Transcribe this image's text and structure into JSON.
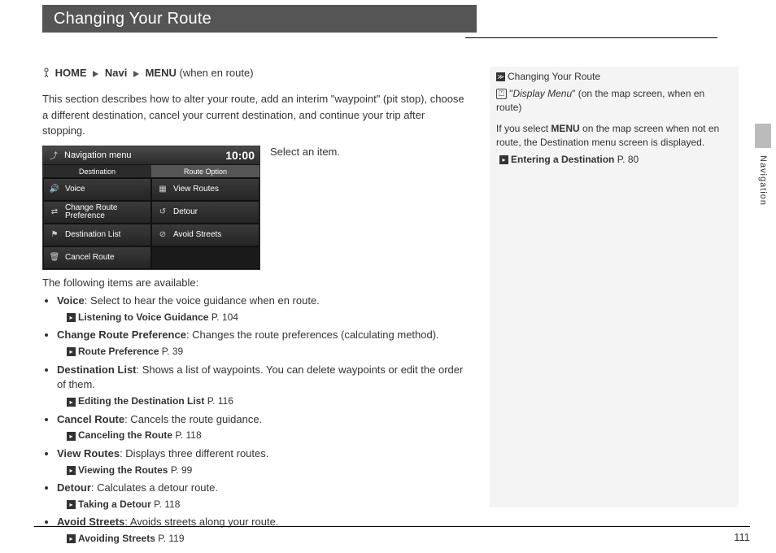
{
  "header": {
    "title": "Changing Your Route"
  },
  "breadcrumb": {
    "home": "HOME",
    "navi": "Navi",
    "menu": "MENU",
    "suffix": "(when en route)"
  },
  "intro": "This section describes how to alter your route, add an interim \"waypoint\" (pit stop), choose a different destination, cancel your current destination, and continue your trip after stopping.",
  "screenshot": {
    "title": "Navigation menu",
    "clock": "10:00",
    "tab_dest": "Destination",
    "tab_route": "Route Option",
    "cells": {
      "voice": "Voice",
      "view_routes": "View Routes",
      "change_pref_l1": "Change Route",
      "change_pref_l2": "Preference",
      "detour": "Detour",
      "dest_list": "Destination List",
      "avoid": "Avoid Streets",
      "cancel": "Cancel Route"
    }
  },
  "instruction": "Select an item.",
  "following": "The following items are available:",
  "items": {
    "voice": {
      "title": "Voice",
      "desc": ": Select to hear the voice guidance when en route.",
      "xref_label": "Listening to Voice Guidance",
      "xref_page": "P. 104"
    },
    "pref": {
      "title": "Change Route Preference",
      "desc": ": Changes the route preferences (calculating method).",
      "xref_label": "Route Preference",
      "xref_page": "P. 39"
    },
    "destlist": {
      "title": "Destination List",
      "desc": ": Shows a list of waypoints. You can delete waypoints or edit the order of them.",
      "xref_label": "Editing the Destination List",
      "xref_page": "P. 116"
    },
    "cancel": {
      "title": "Cancel Route",
      "desc": ": Cancels the route guidance.",
      "xref_label": "Canceling the Route",
      "xref_page": "P. 118"
    },
    "viewroutes": {
      "title": "View Routes",
      "desc": ": Displays three different routes.",
      "xref_label": "Viewing the Routes",
      "xref_page": "P. 99"
    },
    "detour": {
      "title": "Detour",
      "desc": ": Calculates a detour route.",
      "xref_label": "Taking a Detour",
      "xref_page": "P. 118"
    },
    "avoid": {
      "title": "Avoid Streets",
      "desc": ": Avoids streets along your route.",
      "xref_label": "Avoiding Streets",
      "xref_page": "P. 119"
    }
  },
  "sidebar": {
    "heading": "Changing Your Route",
    "voice_cmd": "Display Menu",
    "voice_suffix": "\" (on the map screen, when en route)",
    "note_prefix": "If you select ",
    "note_bold": "MENU",
    "note_suffix": " on the map screen when not en route, the Destination menu screen is displayed.",
    "xref_label": "Entering a Destination",
    "xref_page": "P. 80"
  },
  "tab_label": "Navigation",
  "page_number": "111"
}
